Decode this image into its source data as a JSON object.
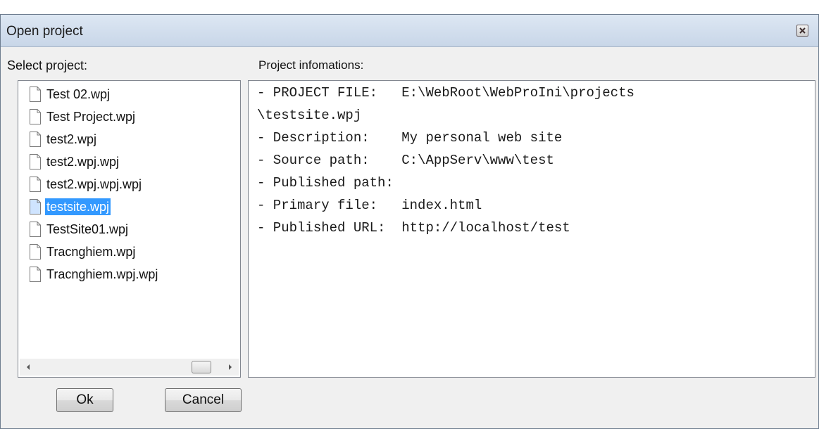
{
  "window": {
    "title": "Open project"
  },
  "left_label": "Select project:",
  "right_label": "Project infomations:",
  "projects": [
    {
      "name": "Test 02.wpj",
      "selected": false
    },
    {
      "name": "Test Project.wpj",
      "selected": false
    },
    {
      "name": "test2.wpj",
      "selected": false
    },
    {
      "name": "test2.wpj.wpj",
      "selected": false
    },
    {
      "name": "test2.wpj.wpj.wpj",
      "selected": false
    },
    {
      "name": "testsite.wpj",
      "selected": true
    },
    {
      "name": "TestSite01.wpj",
      "selected": false
    },
    {
      "name": "Tracnghiem.wpj",
      "selected": false
    },
    {
      "name": "Tracnghiem.wpj.wpj",
      "selected": false
    }
  ],
  "info_lines": [
    "- PROJECT FILE:   E:\\WebRoot\\WebProIni\\projects",
    "\\testsite.wpj",
    "- Description:    My personal web site",
    "- Source path:    C:\\AppServ\\www\\test",
    "- Published path:",
    "- Primary file:   index.html",
    "- Published URL:  http://localhost/test"
  ],
  "buttons": {
    "ok": "Ok",
    "cancel": "Cancel"
  },
  "icons": {
    "close": "close-icon",
    "file": "document-icon",
    "scroll_left": "chevron-left-icon",
    "scroll_right": "chevron-right-icon"
  },
  "colors": {
    "selection": "#3399ff",
    "dialog_bg": "#f0f0f0"
  }
}
